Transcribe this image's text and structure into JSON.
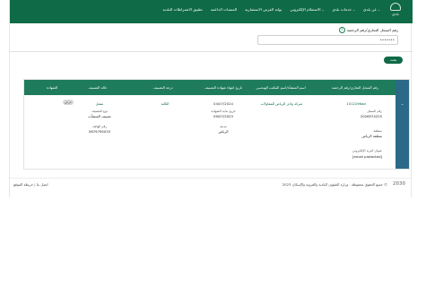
{
  "header": {
    "logo_text": "بلدي",
    "nav": [
      {
        "label": "عن بلدي",
        "dropdown": true
      },
      {
        "label": "خدمات بلدي",
        "dropdown": true
      },
      {
        "label": "الاستعلام الإلكتروني",
        "dropdown": true
      },
      {
        "label": "بوابة الفرص الاستثمارية",
        "dropdown": false
      },
      {
        "label": "المنصات الداعمة",
        "dropdown": false
      },
      {
        "label": "تطبيق الاشتراطات البلدية",
        "dropdown": false
      }
    ]
  },
  "search": {
    "label": "رقم السجل التجاري/رقم الرخصة",
    "help_icon": "?",
    "value": "•••••••"
  },
  "search_button": {
    "label": "بحث"
  },
  "table": {
    "headers": [
      "رقم السجل التجاري/رقم الرخصة",
      "اسم المنشأة/اسم المكتب الهندسي",
      "تاريخ انتهاء شهادة التصنيف",
      "درجة التصنيف",
      "حالة التصنيف",
      "الشهادة"
    ],
    "row": {
      "license_no": "1012296ad",
      "name": "شركة وادي الرياض للمقاولات",
      "expiry": "04/07/2024",
      "grade": "الثالثة",
      "status": "مفعل",
      "certificate_button": "عرض"
    },
    "details": {
      "left": [
        {
          "label": "نوع التصنيف",
          "value": "تصنيف المنشآت"
        },
        {
          "label": "رقم الهاتف",
          "value": "5679795033"
        }
      ],
      "middle": [
        {
          "label": "تاريخ بداية الشهادة",
          "value": "09/07/2023"
        },
        {
          "label": "مدينة",
          "value": "الرياض"
        }
      ],
      "right": [
        {
          "label": "رقم السجل",
          "value": "2026574225"
        },
        {
          "label": "منطقة",
          "value": "منطقة الرياض"
        },
        {
          "label": "عنوان البريد الإلكتروني",
          "value": "[email protected]"
        }
      ]
    }
  },
  "footer": {
    "left": "اتصل بنا | خريطة الموقع",
    "right": "جميع الحقوق محفوظة - وزارة الشؤون البلدية والقروية والإسكان 2023 ©",
    "vision": "2030"
  },
  "colors": {
    "primary": "#0f6a47",
    "table_header": "#1e7b5b",
    "expand_col": "#2a6a88"
  }
}
